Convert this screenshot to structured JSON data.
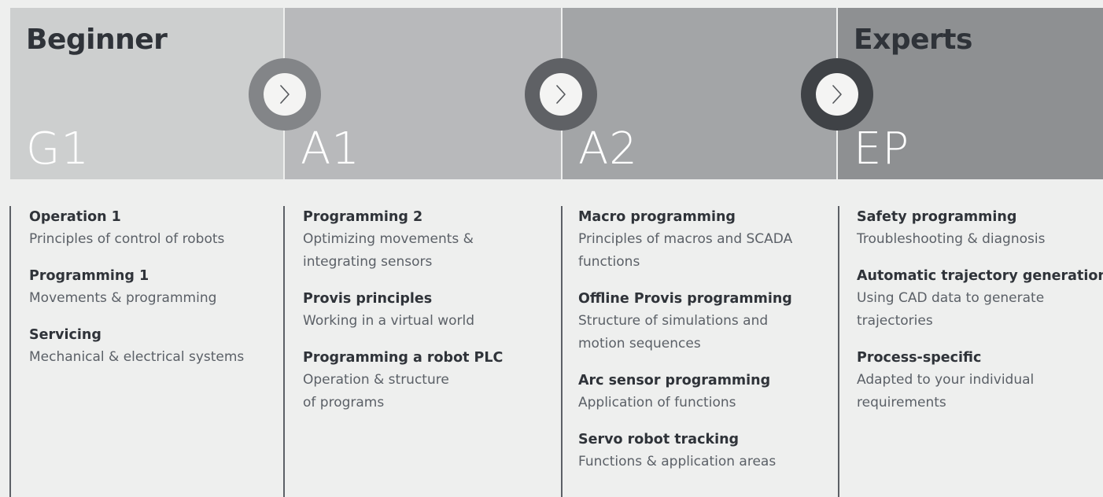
{
  "stages": [
    {
      "title": "Beginner",
      "code": "G1",
      "color": "#cdcfcf"
    },
    {
      "title": "",
      "code": "A1",
      "color": "#b8b9bb"
    },
    {
      "title": "",
      "code": "A2",
      "color": "#a3a5a7"
    },
    {
      "title": "Experts",
      "code": "EP",
      "color": "#8e9092"
    }
  ],
  "arrows": [
    {
      "ring_color": "#838588"
    },
    {
      "ring_color": "#5f6165"
    },
    {
      "ring_color": "#3f4246"
    }
  ],
  "columns": [
    {
      "courses": [
        {
          "title": "Operation 1",
          "desc": "Principles of control of robots"
        },
        {
          "title": "Programming 1",
          "desc": "Movements & programming"
        },
        {
          "title": "Servicing",
          "desc": "Mechanical & electrical systems"
        }
      ]
    },
    {
      "courses": [
        {
          "title": "Programming 2",
          "desc": "Optimizing movements &\nintegrating sensors"
        },
        {
          "title": "Provis principles",
          "desc": "Working in a virtual world"
        },
        {
          "title": "Programming a robot PLC",
          "desc": "Operation & structure\nof programs"
        }
      ]
    },
    {
      "courses": [
        {
          "title": "Macro programming",
          "desc": "Principles of macros and SCADA\nfunctions"
        },
        {
          "title": "Offline Provis programming",
          "desc": "Structure of simulations and\nmotion sequences"
        },
        {
          "title": "Arc sensor programming",
          "desc": "Application of functions"
        },
        {
          "title": "Servo robot tracking",
          "desc": "Functions & application areas"
        }
      ]
    },
    {
      "courses": [
        {
          "title": "Safety programming",
          "desc": "Troubleshooting & diagnosis"
        },
        {
          "title": "Automatic trajectory generation",
          "desc": "Using CAD data to generate\ntrajectories"
        },
        {
          "title": "Process-specific",
          "desc": "Adapted to your individual\nrequirements"
        }
      ]
    }
  ]
}
